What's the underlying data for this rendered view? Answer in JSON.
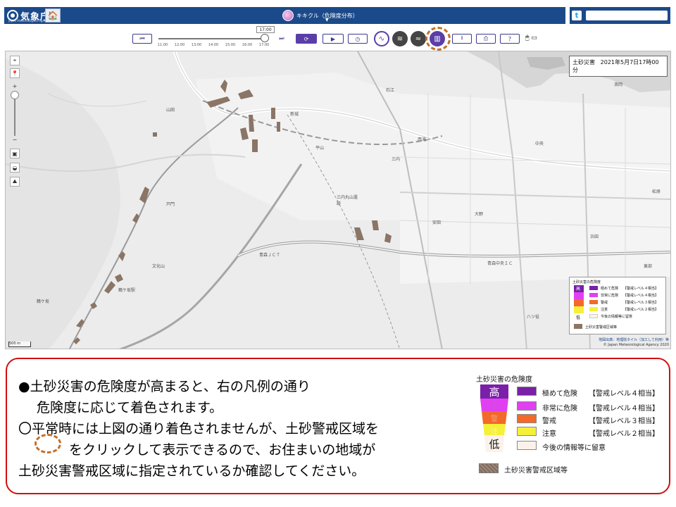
{
  "header": {
    "agency_name": "気象庁",
    "agency_name_en": "Japan Meteorological Agency",
    "title": "キキクル（危険度分布）",
    "title_caret": "▼",
    "home_icon": "🏠",
    "twitter_icon": "t"
  },
  "toolbar": {
    "time_display": "17:00",
    "time_ticks": [
      "11:00",
      "12:00",
      "13:00",
      "14:00",
      "15:00",
      "16:00",
      "17:00"
    ],
    "button_glyphs": {
      "back": "⏮",
      "forward": "⏭",
      "refresh": "⟳",
      "play": "▶",
      "speed": "◷",
      "landslide": "∿",
      "flood": "≋",
      "river": "≈",
      "zone": "▥",
      "download": "⭳",
      "print": "⎙",
      "help": "?",
      "mouse": "🖱 ▭"
    },
    "circle_colors": [
      "#5a3ea8",
      "#444444",
      "#444444",
      "#5a3ea8"
    ]
  },
  "map": {
    "title": "土砂災害",
    "datetime": "2021年5月7日17時00分",
    "scale_label": "500 m",
    "controls": [
      "⌖",
      "📍",
      "+",
      "−",
      "▣",
      "◒",
      "⛰"
    ],
    "place_labels": [
      "山田",
      "新城",
      "平山",
      "石江",
      "西滝",
      "三内",
      "戸門",
      "大野",
      "中央",
      "安田",
      "青森ＪＣＴ",
      "鶴ケ坂駅",
      "鶴ケ坂",
      "浪岡",
      "浜田",
      "松原",
      "文化山",
      "三内丸山遺跡",
      "青森中央ＩＣ",
      "八ツ役",
      "桜川",
      "東部"
    ],
    "copyright_source": "地図出典：地理院タイル（加工して利用）等",
    "copyright_owner": "© Japan Meteorological Agency 2020",
    "legend": {
      "title": "土砂災害の危険度",
      "high": "高",
      "low": "低",
      "items": [
        {
          "label": "極めて危険",
          "level": "【警戒レベル４相当】",
          "color": "#7a1fa8"
        },
        {
          "label": "非常に危険",
          "level": "【警戒レベル４相当】",
          "color": "#e040f0"
        },
        {
          "label": "警戒",
          "level": "【警戒レベル３相当】",
          "color": "#f2692a"
        },
        {
          "label": "注意",
          "level": "【警戒レベル２相当】",
          "color": "#f5f03a"
        },
        {
          "label": "今後の情報等に留意",
          "level": "",
          "color": "#fbf2ea"
        }
      ],
      "zone_label": "土砂災害警戒区域等"
    }
  },
  "note": {
    "line1": "●土砂災害の危険度が高まると、右の凡例の通り",
    "line2": "危険度に応じて着色されます。",
    "line3": "〇平常時には上図の通り着色されませんが、土砂警戒区域を",
    "line4": "をクリックして表示できるので、お住まいの地域が",
    "line5": "土砂災害警戒区域に指定されているか確認してください。"
  },
  "legend": {
    "title": "土砂災害の危険度",
    "high": "高",
    "low": "低",
    "bar_mid_labels": [
      "極",
      "非",
      "警",
      "注"
    ],
    "items": [
      {
        "label": "極めて危険",
        "level": "【警戒レベル４相当】",
        "color": "#7a1fa8"
      },
      {
        "label": "非常に危険",
        "level": "【警戒レベル４相当】",
        "color": "#e040f0"
      },
      {
        "label": "警戒",
        "level": "【警戒レベル３相当】",
        "color": "#f2692a"
      },
      {
        "label": "注意",
        "level": "【警戒レベル２相当】",
        "color": "#f5f03a"
      },
      {
        "label": "今後の情報等に留意",
        "level": "",
        "color": "#fbf2ea"
      }
    ],
    "zone_label": "土砂災害警戒区域等"
  }
}
